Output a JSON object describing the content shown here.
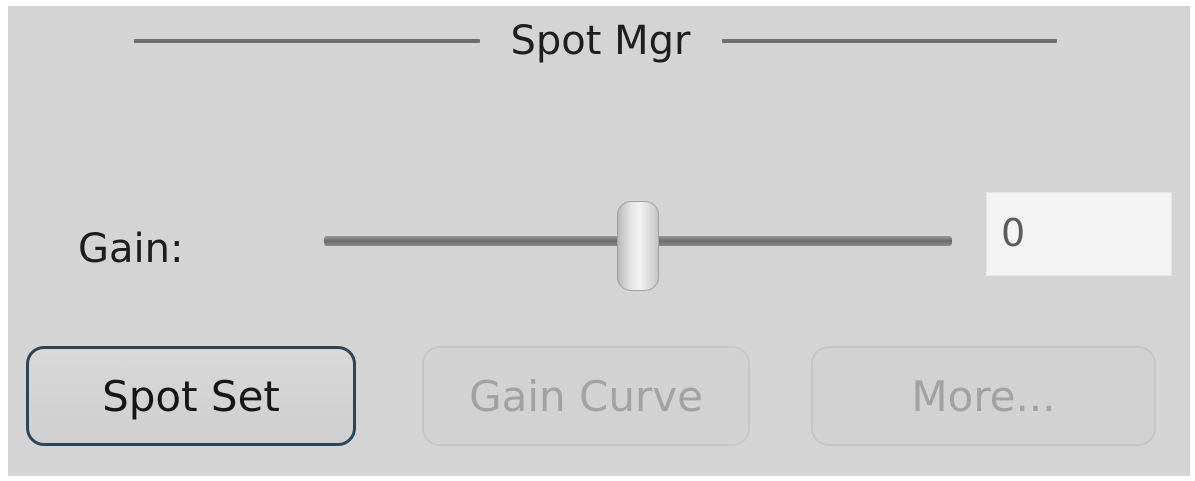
{
  "panel": {
    "title": "Spot Mgr"
  },
  "gain": {
    "label": "Gain:",
    "slider_fraction": 0.5,
    "value": "0"
  },
  "buttons": {
    "spot_set": "Spot Set",
    "gain_curve": "Gain Curve",
    "more": "More..."
  },
  "colors": {
    "panel_bg": "#d4d4d4",
    "primary_border": "#2c4558",
    "disabled_text": "#a2a2a2"
  }
}
